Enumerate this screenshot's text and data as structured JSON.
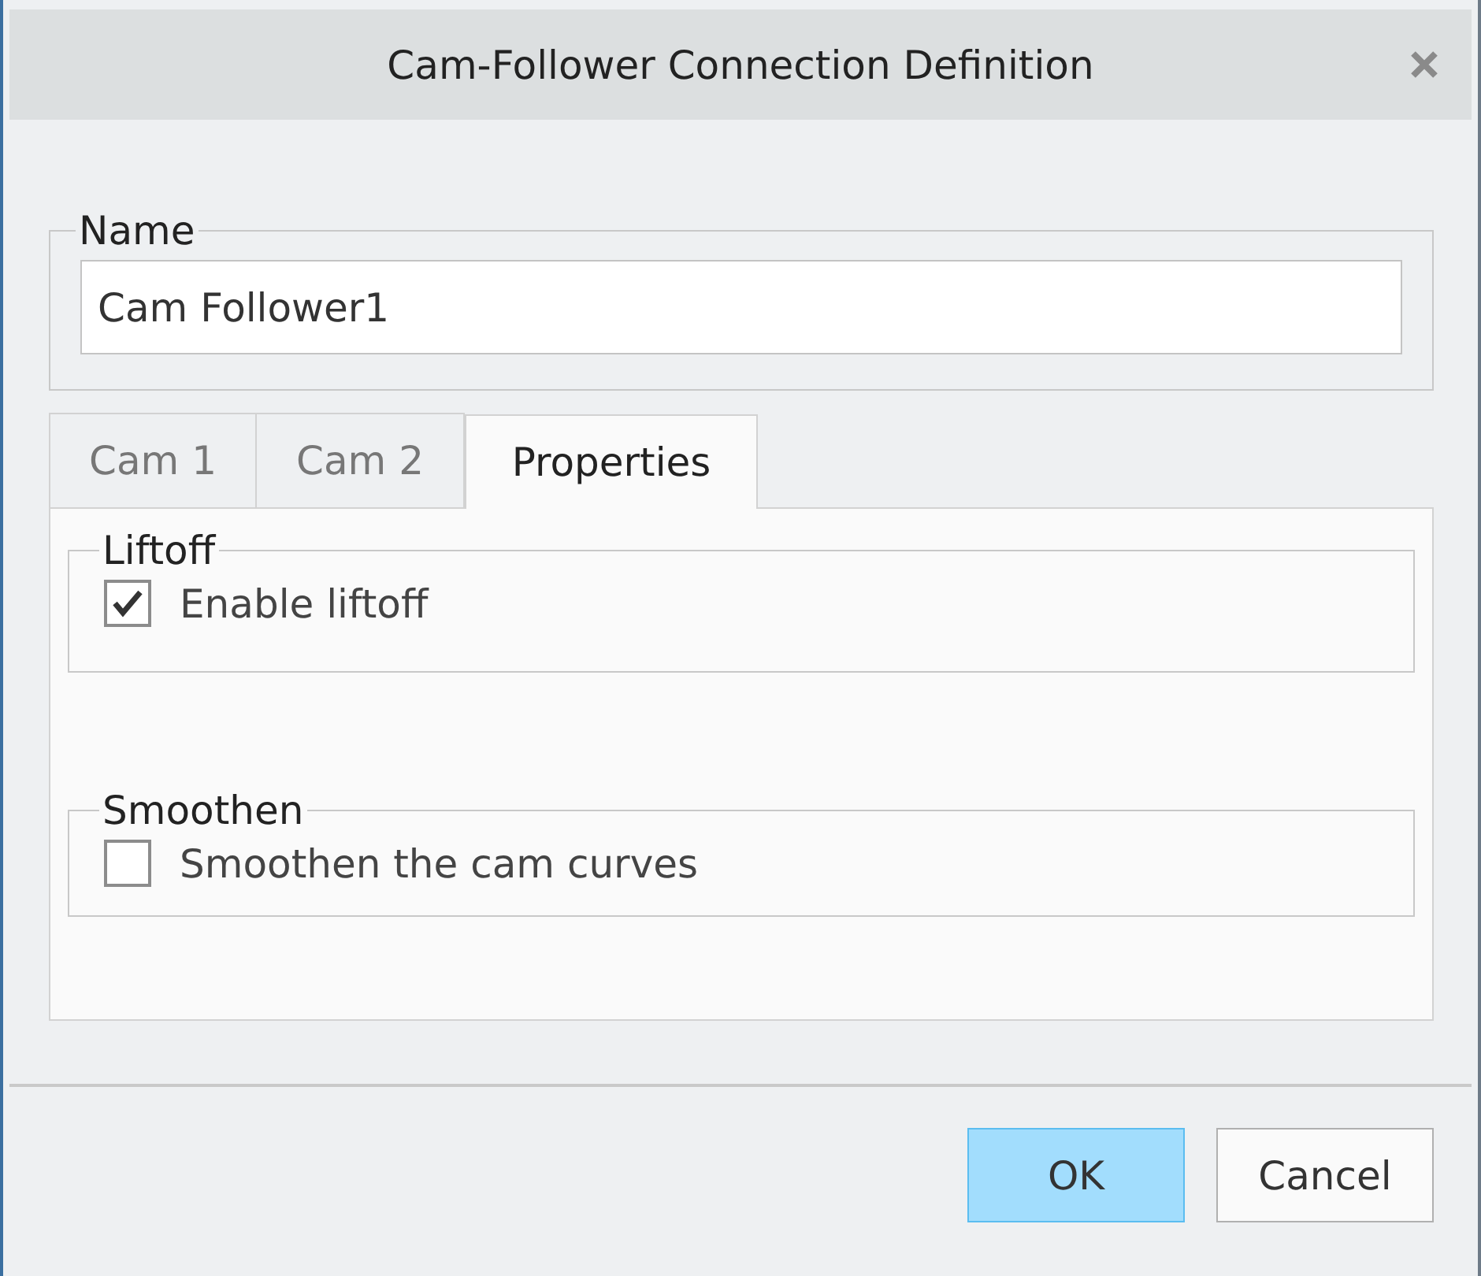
{
  "window": {
    "title": "Cam-Follower Connection Definition"
  },
  "name_group": {
    "label": "Name",
    "value": "Cam Follower1"
  },
  "tabs": [
    {
      "label": "Cam 1",
      "selected": false
    },
    {
      "label": "Cam 2",
      "selected": false
    },
    {
      "label": "Properties",
      "selected": true
    }
  ],
  "groups": [
    {
      "title": "Liftoff",
      "option": {
        "label": "Enable liftoff",
        "checked": true
      }
    },
    {
      "title": "Smoothen",
      "option": {
        "label": "Smoothen the cam curves",
        "checked": false
      }
    }
  ],
  "buttons": [
    {
      "label": "OK",
      "kind": "primary"
    },
    {
      "label": "Cancel",
      "kind": "secondary"
    }
  ]
}
